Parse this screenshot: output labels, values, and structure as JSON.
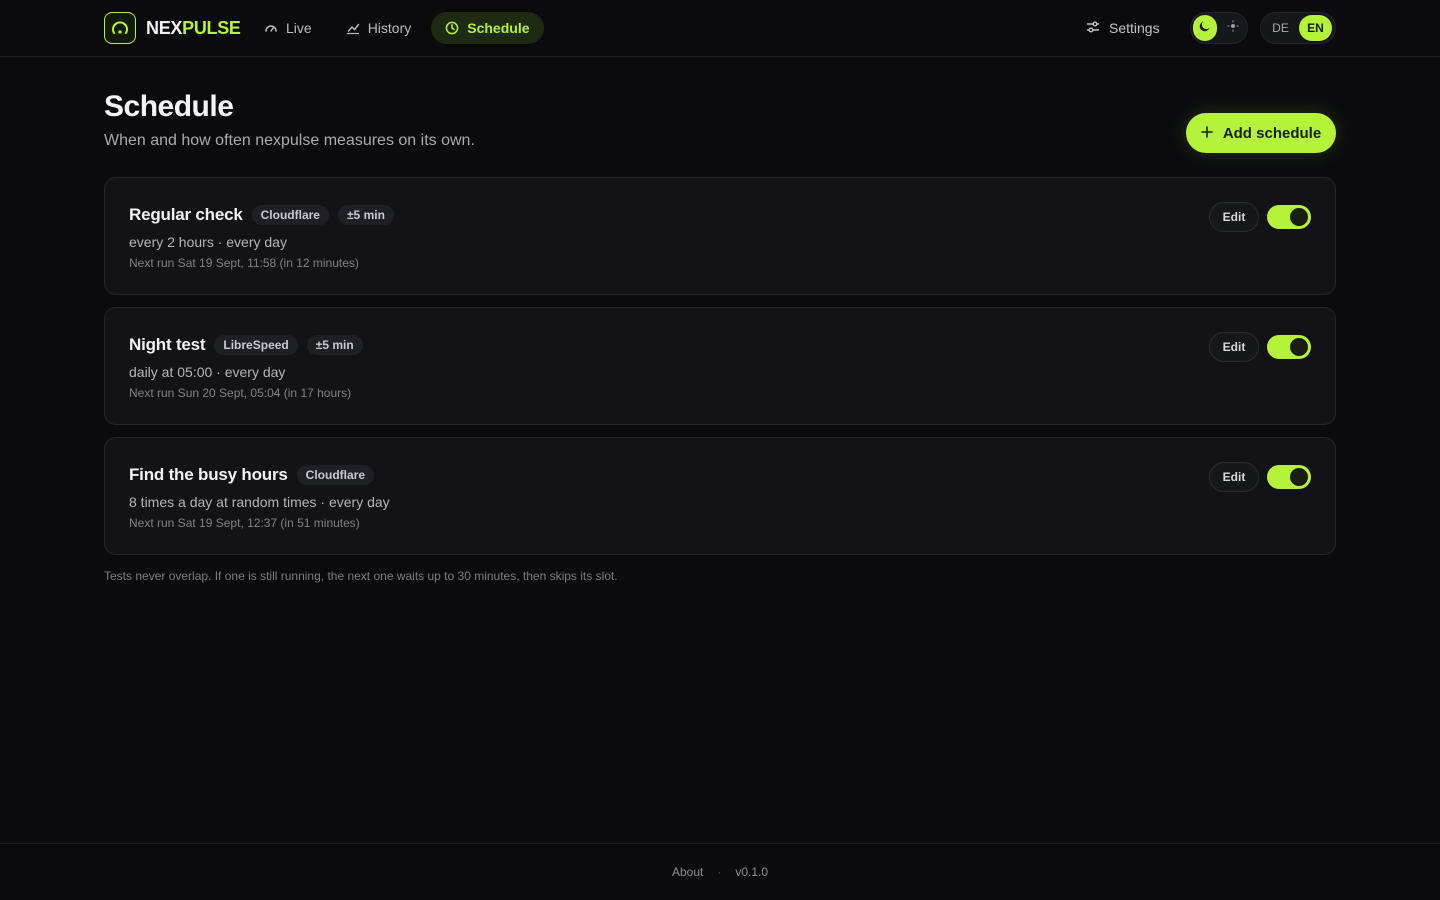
{
  "brand": {
    "name_part1": "NEX",
    "name_part2": "PULSE",
    "logo_icon": "gauge-icon",
    "accent": "#b5f23a"
  },
  "nav": [
    {
      "label": "Live",
      "icon": "gauge-small-icon",
      "active": false
    },
    {
      "label": "History",
      "icon": "line-chart-icon",
      "active": false
    },
    {
      "label": "Schedule",
      "icon": "clock-icon",
      "active": true
    }
  ],
  "header": {
    "settings_label": "Settings",
    "theme": {
      "selected": "dark",
      "options": [
        "moon-icon",
        "sun-icon"
      ]
    },
    "languages": [
      "DE",
      "EN"
    ],
    "selected_language": "EN"
  },
  "page": {
    "title": "Schedule",
    "subtitle": "When and how often nexpulse measures on its own.",
    "add_button_label": "Add schedule"
  },
  "schedules": [
    {
      "title": "Regular check",
      "chips": [
        "Cloudflare",
        "±5 min"
      ],
      "frequency": "every 2 hours · every day",
      "next_run": "Next run Sat 19 Sept, 11:58 (in 12 minutes)",
      "edit_label": "Edit",
      "enabled": true
    },
    {
      "title": "Night test",
      "chips": [
        "LibreSpeed",
        "±5 min"
      ],
      "frequency": "daily at 05:00 · every day",
      "next_run": "Next run Sun 20 Sept, 05:04 (in 17 hours)",
      "edit_label": "Edit",
      "enabled": true
    },
    {
      "title": "Find the busy hours",
      "chips": [
        "Cloudflare"
      ],
      "frequency": "8 times a day at random times · every day",
      "next_run": "Next run Sat 19 Sept, 12:37 (in 51 minutes)",
      "edit_label": "Edit",
      "enabled": true
    }
  ],
  "note": "Tests never overlap. If one is still running, the next one waits up to 30 minutes, then skips its slot.",
  "footer": {
    "about_label": "About",
    "separator": "·",
    "version": "v0.1.0"
  }
}
